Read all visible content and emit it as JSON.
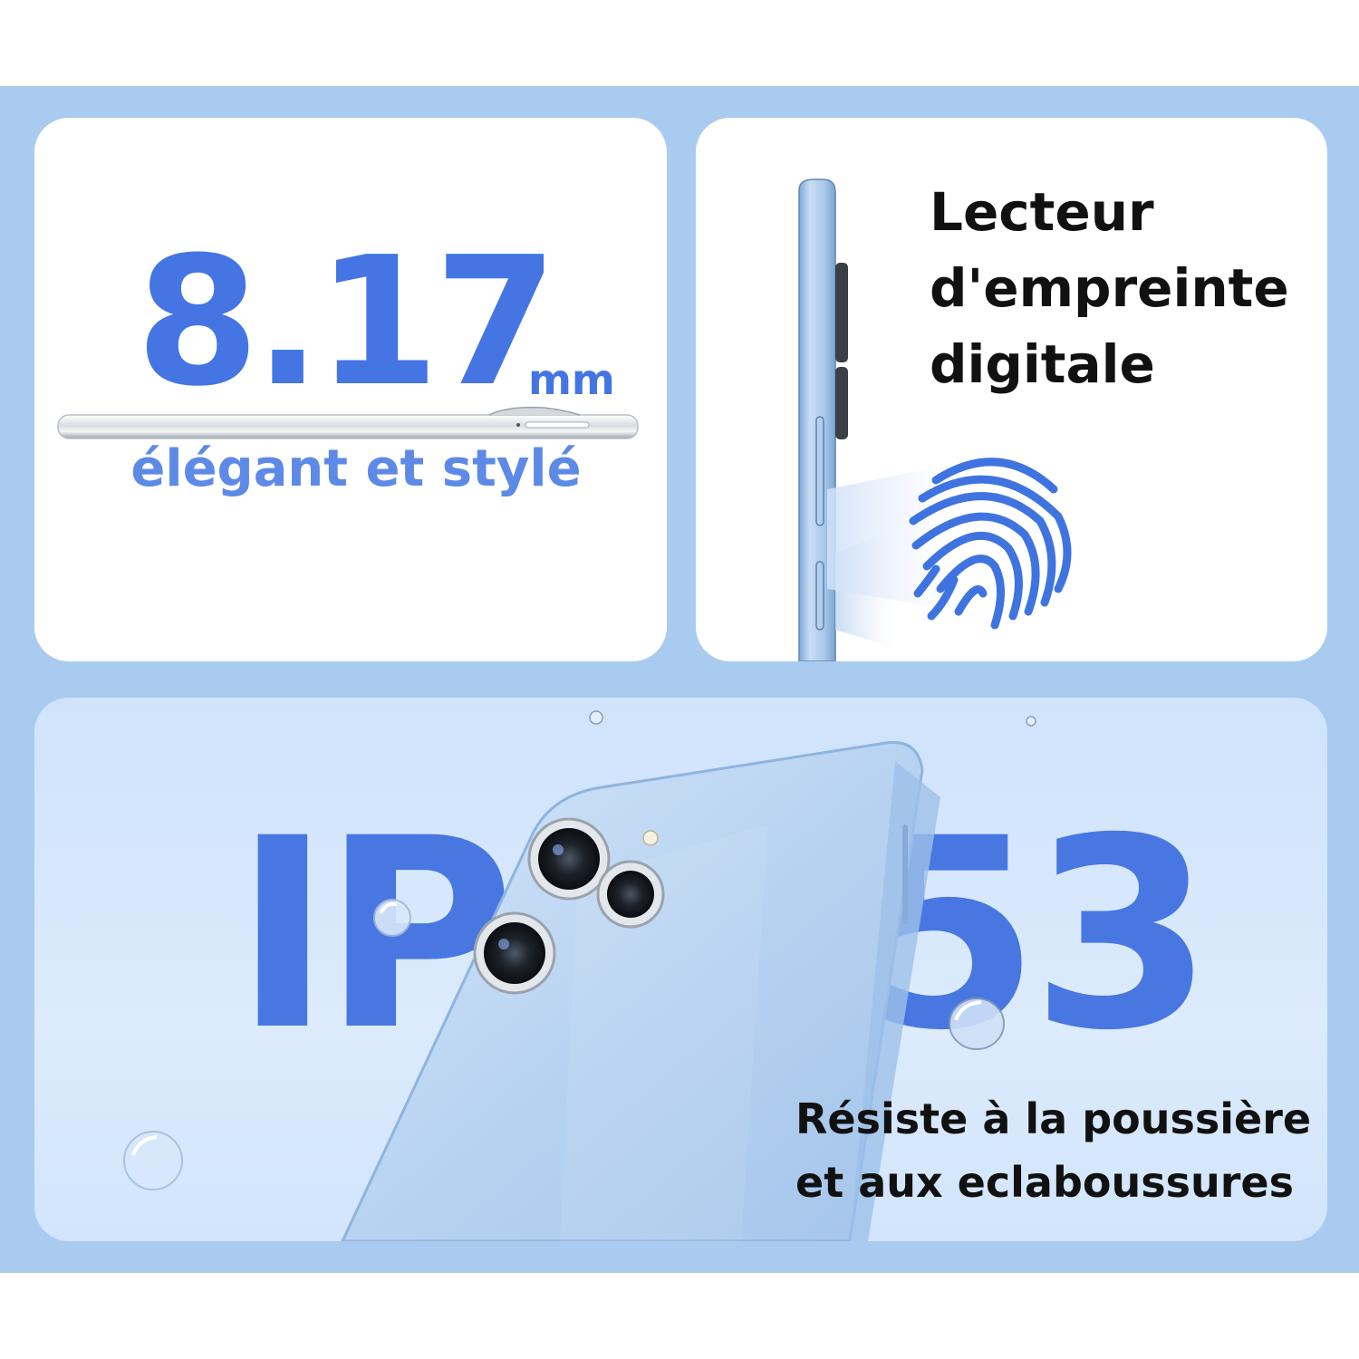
{
  "thin_card": {
    "value": "8.17",
    "unit": "mm",
    "caption": "élégant et stylé"
  },
  "fingerprint_card": {
    "title_lines": [
      "Lecteur",
      "d'empreinte",
      "digitale"
    ]
  },
  "ip_card": {
    "rating_left": "IP",
    "rating_right": "53",
    "caption_lines": [
      "Résiste à la poussière",
      "et aux eclaboussures"
    ]
  },
  "colors": {
    "background_band": "#a9cbf0",
    "accent_blue": "#4475e3",
    "phone_blue": "#b9d6f3"
  },
  "icons": [
    "phone-side-icon",
    "phone-edge-icon",
    "fingerprint-icon",
    "phone-back-icon",
    "water-droplet-icon"
  ]
}
